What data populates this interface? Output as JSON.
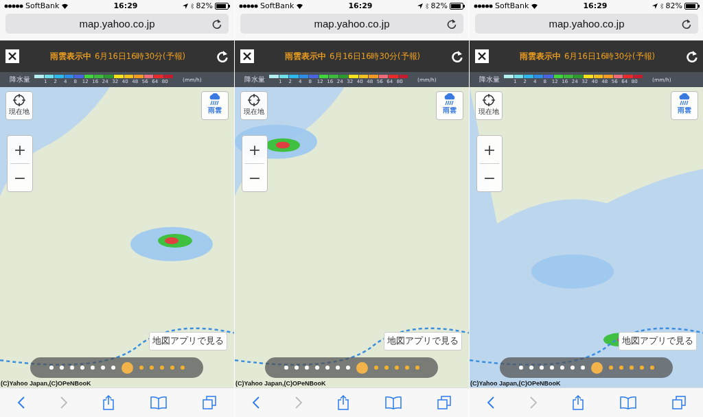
{
  "panels": [
    {
      "status": {
        "carrier": "SoftBank",
        "time": "16:29",
        "battery": "82%"
      },
      "url": "map.yahoo.co.jp",
      "header": {
        "label": "雨雲表示中",
        "datetime": "6月16日16時30分(予報)"
      },
      "legend": {
        "title": "降水量",
        "swatches": [
          {
            "color": "#b4eef0"
          },
          {
            "color": "#6fe0ea"
          },
          {
            "color": "#2cb8ee"
          },
          {
            "color": "#2c8ee8"
          },
          {
            "color": "#4a64e0"
          },
          {
            "color": "#3ed63a"
          },
          {
            "color": "#3cba3a"
          },
          {
            "color": "#2c9a2c"
          },
          {
            "color": "#f4e21e"
          },
          {
            "color": "#f2c01e"
          },
          {
            "color": "#f29a22"
          },
          {
            "color": "#ee6a7a"
          },
          {
            "color": "#e82a2a"
          },
          {
            "color": "#c41e2e"
          }
        ],
        "ticks": [
          "1",
          "2",
          "4",
          "8",
          "12",
          "16",
          "24",
          "32",
          "40",
          "48",
          "56",
          "64",
          "80"
        ],
        "unit": "(mm/h)"
      },
      "locate_label": "現在地",
      "rain_label": "雨雲",
      "zoom_in": "+",
      "zoom_out": "−",
      "app_button": "地図アプリで見る",
      "copyright": "(C)Yahoo Japan,(C)OPeNBooK",
      "timeline": [
        {
          "kind": "past",
          "selected": false
        },
        {
          "kind": "past",
          "selected": false
        },
        {
          "kind": "past",
          "selected": false
        },
        {
          "kind": "past",
          "selected": false
        },
        {
          "kind": "past",
          "selected": false
        },
        {
          "kind": "past",
          "selected": false
        },
        {
          "kind": "past",
          "selected": false
        },
        {
          "kind": "forecast",
          "selected": true
        },
        {
          "kind": "forecast",
          "selected": false
        },
        {
          "kind": "forecast",
          "selected": false
        },
        {
          "kind": "forecast",
          "selected": false
        },
        {
          "kind": "forecast",
          "selected": false
        },
        {
          "kind": "forecast",
          "selected": false
        }
      ],
      "toolbar": {
        "forward_disabled": true
      }
    },
    {
      "status": {
        "carrier": "SoftBank",
        "time": "16:29",
        "battery": "82%"
      },
      "url": "map.yahoo.co.jp",
      "header": {
        "label": "雨雲表示中",
        "datetime": "6月16日16時30分(予報)"
      },
      "legend": {
        "title": "降水量",
        "swatches": [
          {
            "color": "#b4eef0"
          },
          {
            "color": "#6fe0ea"
          },
          {
            "color": "#2cb8ee"
          },
          {
            "color": "#2c8ee8"
          },
          {
            "color": "#4a64e0"
          },
          {
            "color": "#3ed63a"
          },
          {
            "color": "#3cba3a"
          },
          {
            "color": "#2c9a2c"
          },
          {
            "color": "#f4e21e"
          },
          {
            "color": "#f2c01e"
          },
          {
            "color": "#f29a22"
          },
          {
            "color": "#ee6a7a"
          },
          {
            "color": "#e82a2a"
          },
          {
            "color": "#c41e2e"
          }
        ],
        "ticks": [
          "1",
          "2",
          "4",
          "8",
          "12",
          "16",
          "24",
          "32",
          "40",
          "48",
          "56",
          "64",
          "80"
        ],
        "unit": "(mm/h)"
      },
      "locate_label": "現在地",
      "rain_label": "雨雲",
      "zoom_in": "+",
      "zoom_out": "−",
      "app_button": "地図アプリで見る",
      "copyright": "(C)Yahoo Japan,(C)OPeNBooK",
      "timeline": [
        {
          "kind": "past",
          "selected": false
        },
        {
          "kind": "past",
          "selected": false
        },
        {
          "kind": "past",
          "selected": false
        },
        {
          "kind": "past",
          "selected": false
        },
        {
          "kind": "past",
          "selected": false
        },
        {
          "kind": "past",
          "selected": false
        },
        {
          "kind": "past",
          "selected": false
        },
        {
          "kind": "forecast",
          "selected": true
        },
        {
          "kind": "forecast",
          "selected": false
        },
        {
          "kind": "forecast",
          "selected": false
        },
        {
          "kind": "forecast",
          "selected": false
        },
        {
          "kind": "forecast",
          "selected": false
        },
        {
          "kind": "forecast",
          "selected": false
        }
      ],
      "toolbar": {
        "forward_disabled": true
      }
    },
    {
      "status": {
        "carrier": "SoftBank",
        "time": "16:29",
        "battery": "82%"
      },
      "url": "map.yahoo.co.jp",
      "header": {
        "label": "雨雲表示中",
        "datetime": "6月16日16時30分(予報)"
      },
      "legend": {
        "title": "降水量",
        "swatches": [
          {
            "color": "#b4eef0"
          },
          {
            "color": "#6fe0ea"
          },
          {
            "color": "#2cb8ee"
          },
          {
            "color": "#2c8ee8"
          },
          {
            "color": "#4a64e0"
          },
          {
            "color": "#3ed63a"
          },
          {
            "color": "#3cba3a"
          },
          {
            "color": "#2c9a2c"
          },
          {
            "color": "#f4e21e"
          },
          {
            "color": "#f2c01e"
          },
          {
            "color": "#f29a22"
          },
          {
            "color": "#ee6a7a"
          },
          {
            "color": "#e82a2a"
          },
          {
            "color": "#c41e2e"
          }
        ],
        "ticks": [
          "1",
          "2",
          "4",
          "8",
          "12",
          "16",
          "24",
          "32",
          "40",
          "48",
          "56",
          "64",
          "80"
        ],
        "unit": "(mm/h)"
      },
      "locate_label": "現在地",
      "rain_label": "雨雲",
      "zoom_in": "+",
      "zoom_out": "−",
      "app_button": "地図アプリで見る",
      "copyright": "(C)Yahoo Japan,(C)OPeNBooK",
      "timeline": [
        {
          "kind": "past",
          "selected": false
        },
        {
          "kind": "past",
          "selected": false
        },
        {
          "kind": "past",
          "selected": false
        },
        {
          "kind": "past",
          "selected": false
        },
        {
          "kind": "past",
          "selected": false
        },
        {
          "kind": "past",
          "selected": false
        },
        {
          "kind": "past",
          "selected": false
        },
        {
          "kind": "forecast",
          "selected": true
        },
        {
          "kind": "forecast",
          "selected": false
        },
        {
          "kind": "forecast",
          "selected": false
        },
        {
          "kind": "forecast",
          "selected": false
        },
        {
          "kind": "forecast",
          "selected": false
        },
        {
          "kind": "forecast",
          "selected": false
        }
      ],
      "toolbar": {
        "forward_disabled": true
      }
    }
  ]
}
